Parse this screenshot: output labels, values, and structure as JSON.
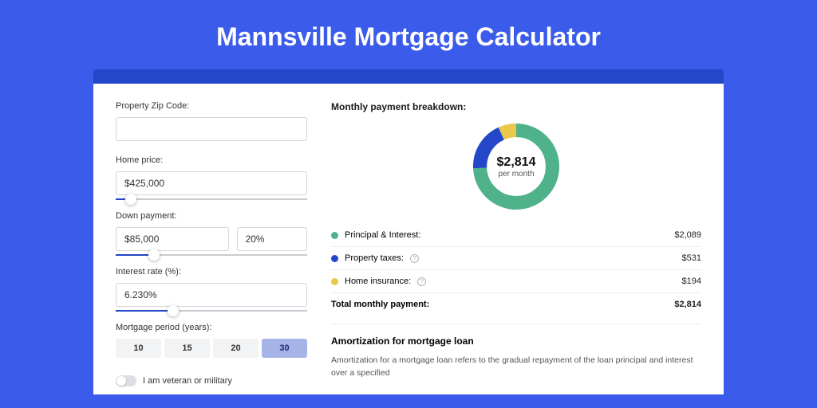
{
  "page_title": "Mannsville Mortgage Calculator",
  "form": {
    "zip_label": "Property Zip Code:",
    "zip_value": "",
    "price_label": "Home price:",
    "price_value": "$425,000",
    "price_slider_pct": 8,
    "down_label": "Down payment:",
    "down_value": "$85,000",
    "down_pct_value": "20%",
    "down_slider_pct": 20,
    "rate_label": "Interest rate (%):",
    "rate_value": "6.230%",
    "rate_slider_pct": 30,
    "period_label": "Mortgage period (years):",
    "periods": [
      "10",
      "15",
      "20",
      "30"
    ],
    "period_selected": "30",
    "veteran_label": "I am veteran or military"
  },
  "breakdown": {
    "title": "Monthly payment breakdown:",
    "center_amount": "$2,814",
    "center_label": "per month",
    "rows": [
      {
        "color": "green",
        "label": "Principal & Interest:",
        "info": false,
        "value": "$2,089"
      },
      {
        "color": "blue",
        "label": "Property taxes:",
        "info": true,
        "value": "$531"
      },
      {
        "color": "yellow",
        "label": "Home insurance:",
        "info": true,
        "value": "$194"
      }
    ],
    "total_label": "Total monthly payment:",
    "total_value": "$2,814"
  },
  "amortization": {
    "title": "Amortization for mortgage loan",
    "text": "Amortization for a mortgage loan refers to the gradual repayment of the loan principal and interest over a specified"
  },
  "chart_data": {
    "type": "pie",
    "title": "Monthly payment breakdown",
    "series": [
      {
        "name": "Principal & Interest",
        "value": 2089,
        "color": "#50b28a"
      },
      {
        "name": "Property taxes",
        "value": 531,
        "color": "#2447c9"
      },
      {
        "name": "Home insurance",
        "value": 194,
        "color": "#e9c94a"
      }
    ],
    "total": 2814,
    "center_label": "$2,814 per month"
  }
}
